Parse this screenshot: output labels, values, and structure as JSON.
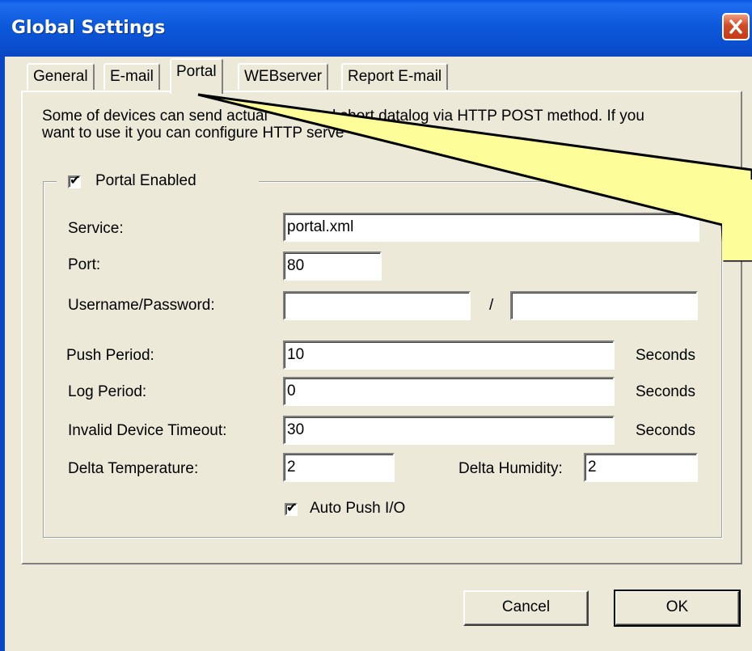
{
  "window": {
    "title": "Global Settings"
  },
  "tabs": [
    {
      "label": "General",
      "active": false
    },
    {
      "label": "E-mail",
      "active": false
    },
    {
      "label": "Portal",
      "active": true
    },
    {
      "label": "WEBserver",
      "active": false
    },
    {
      "label": "Report E-mail",
      "active": false
    }
  ],
  "description": {
    "line1": "Some of devices can send actual",
    "line1_hidden": "and short datalog via HTTP POST method. If you",
    "line2": "want to use it you can configure HTTP serve"
  },
  "portal": {
    "enabled_label": "Portal Enabled",
    "enabled": true,
    "service": {
      "label": "Service:",
      "value": "portal.xml"
    },
    "port": {
      "label": "Port:",
      "value": "80"
    },
    "credentials": {
      "label": "Username/Password:",
      "username": "",
      "separator": "/",
      "password": ""
    },
    "push_period": {
      "label": "Push Period:",
      "value": "10",
      "unit": "Seconds"
    },
    "log_period": {
      "label": "Log Period:",
      "value": "0",
      "unit": "Seconds"
    },
    "invalid_timeout": {
      "label": "Invalid Device Timeout:",
      "value": "30",
      "unit": "Seconds"
    },
    "delta_temperature": {
      "label": "Delta Temperature:",
      "value": "2"
    },
    "delta_humidity": {
      "label": "Delta Humidity:",
      "value": "2"
    },
    "auto_push_label": "Auto Push I/O",
    "auto_push": true
  },
  "buttons": {
    "cancel": "Cancel",
    "ok": "OK"
  },
  "colors": {
    "titlebar": "#0a58e3",
    "callout_fill": "#fdfd9a",
    "dialog_bg": "#ece9d8"
  }
}
